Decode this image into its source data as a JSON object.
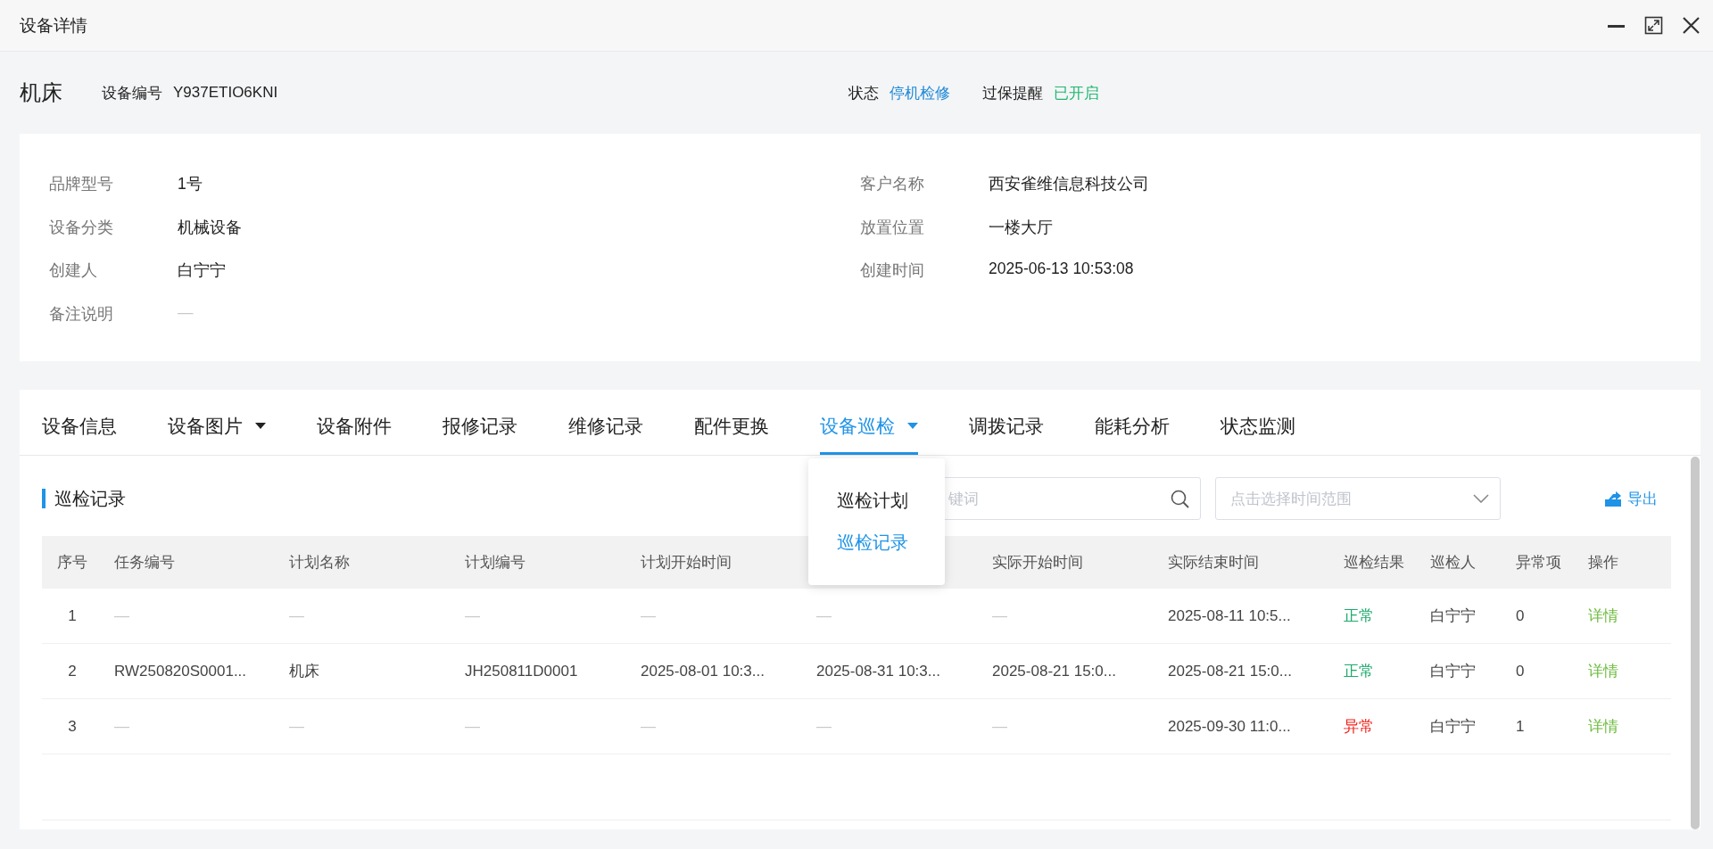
{
  "window": {
    "title": "设备详情"
  },
  "header": {
    "name": "机床",
    "code_label": "设备编号",
    "code": "Y937ETIO6KNI",
    "status_label": "状态",
    "status": "停机检修",
    "warranty_label": "过保提醒",
    "warranty": "已开启"
  },
  "details": [
    {
      "label": "品牌型号",
      "value": "1号",
      "kind": "text"
    },
    {
      "label": "客户名称",
      "value": "西安雀维信息科技公司",
      "kind": "text"
    },
    {
      "label": "设备分类",
      "value": "机械设备",
      "kind": "text"
    },
    {
      "label": "放置位置",
      "value": "一楼大厅",
      "kind": "text"
    },
    {
      "label": "创建人",
      "value": "白宁宁",
      "kind": "text"
    },
    {
      "label": "创建时间",
      "value": "2025-06-13 10:53:08",
      "kind": "text"
    },
    {
      "label": "备注说明",
      "value": "—",
      "kind": "empty"
    }
  ],
  "tabs": [
    {
      "label": "设备信息",
      "selected": false,
      "has_menu": false
    },
    {
      "label": "设备图片",
      "selected": false,
      "has_menu": true
    },
    {
      "label": "设备附件",
      "selected": false,
      "has_menu": false
    },
    {
      "label": "报修记录",
      "selected": false,
      "has_menu": false
    },
    {
      "label": "维修记录",
      "selected": false,
      "has_menu": false
    },
    {
      "label": "配件更换",
      "selected": false,
      "has_menu": false
    },
    {
      "label": "设备巡检",
      "selected": true,
      "has_menu": true
    },
    {
      "label": "调拨记录",
      "selected": false,
      "has_menu": false
    },
    {
      "label": "能耗分析",
      "selected": false,
      "has_menu": false
    },
    {
      "label": "状态监测",
      "selected": false,
      "has_menu": false
    }
  ],
  "tab_menu": {
    "items": [
      {
        "label": "巡检计划",
        "selected": false
      },
      {
        "label": "巡检记录",
        "selected": true
      }
    ]
  },
  "toolbar": {
    "section_title": "巡检记录",
    "search": {
      "placeholder": "键词"
    },
    "date_range": {
      "placeholder": "点击选择时间范围"
    },
    "export": "导出"
  },
  "table": {
    "columns": [
      {
        "label": "序号"
      },
      {
        "label": "任务编号"
      },
      {
        "label": "计划名称"
      },
      {
        "label": "计划编号"
      },
      {
        "label": "计划开始时间"
      },
      {},
      {
        "label": "实际开始时间"
      },
      {
        "label": "实际结束时间"
      },
      {
        "label": "巡检结果"
      },
      {
        "label": "巡检人"
      },
      {
        "label": "异常项"
      },
      {
        "label": "操作"
      }
    ],
    "rows": [
      [
        {
          "text": "1",
          "kind": "text"
        },
        {
          "text": "—",
          "kind": "empty"
        },
        {
          "text": "—",
          "kind": "empty"
        },
        {
          "text": "—",
          "kind": "empty"
        },
        {
          "text": "—",
          "kind": "empty"
        },
        {
          "text": "—",
          "kind": "empty"
        },
        {
          "text": "—",
          "kind": "empty"
        },
        {
          "text": "2025-08-11 10:5...",
          "kind": "text"
        },
        {
          "text": "正常",
          "kind": "ok"
        },
        {
          "text": "白宁宁",
          "kind": "text"
        },
        {
          "text": "0",
          "kind": "text"
        },
        {
          "text": "详情",
          "kind": "link"
        }
      ],
      [
        {
          "text": "2",
          "kind": "text"
        },
        {
          "text": "RW250820S0001...",
          "kind": "text"
        },
        {
          "text": "机床",
          "kind": "text"
        },
        {
          "text": "JH250811D0001",
          "kind": "text"
        },
        {
          "text": "2025-08-01 10:3...",
          "kind": "text"
        },
        {
          "text": "2025-08-31 10:3...",
          "kind": "text"
        },
        {
          "text": "2025-08-21 15:0...",
          "kind": "text"
        },
        {
          "text": "2025-08-21 15:0...",
          "kind": "text"
        },
        {
          "text": "正常",
          "kind": "ok"
        },
        {
          "text": "白宁宁",
          "kind": "text"
        },
        {
          "text": "0",
          "kind": "text"
        },
        {
          "text": "详情",
          "kind": "link"
        }
      ],
      [
        {
          "text": "3",
          "kind": "text"
        },
        {
          "text": "—",
          "kind": "empty"
        },
        {
          "text": "—",
          "kind": "empty"
        },
        {
          "text": "—",
          "kind": "empty"
        },
        {
          "text": "—",
          "kind": "empty"
        },
        {
          "text": "—",
          "kind": "empty"
        },
        {
          "text": "—",
          "kind": "empty"
        },
        {
          "text": "2025-09-30 11:0...",
          "kind": "text"
        },
        {
          "text": "异常",
          "kind": "error"
        },
        {
          "text": "白宁宁",
          "kind": "text"
        },
        {
          "text": "1",
          "kind": "text"
        },
        {
          "text": "详情",
          "kind": "link"
        }
      ]
    ]
  }
}
